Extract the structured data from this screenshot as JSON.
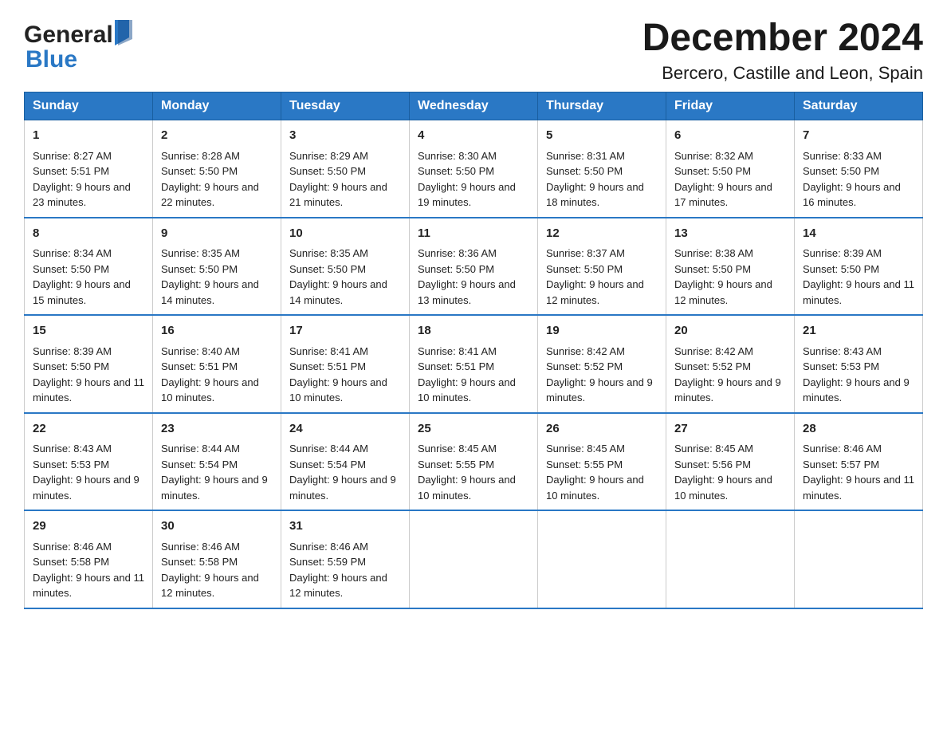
{
  "header": {
    "title": "December 2024",
    "subtitle": "Bercero, Castille and Leon, Spain",
    "logo_general": "General",
    "logo_blue": "Blue"
  },
  "days_of_week": [
    "Sunday",
    "Monday",
    "Tuesday",
    "Wednesday",
    "Thursday",
    "Friday",
    "Saturday"
  ],
  "weeks": [
    [
      {
        "day": "1",
        "sunrise": "8:27 AM",
        "sunset": "5:51 PM",
        "daylight": "9 hours and 23 minutes."
      },
      {
        "day": "2",
        "sunrise": "8:28 AM",
        "sunset": "5:50 PM",
        "daylight": "9 hours and 22 minutes."
      },
      {
        "day": "3",
        "sunrise": "8:29 AM",
        "sunset": "5:50 PM",
        "daylight": "9 hours and 21 minutes."
      },
      {
        "day": "4",
        "sunrise": "8:30 AM",
        "sunset": "5:50 PM",
        "daylight": "9 hours and 19 minutes."
      },
      {
        "day": "5",
        "sunrise": "8:31 AM",
        "sunset": "5:50 PM",
        "daylight": "9 hours and 18 minutes."
      },
      {
        "day": "6",
        "sunrise": "8:32 AM",
        "sunset": "5:50 PM",
        "daylight": "9 hours and 17 minutes."
      },
      {
        "day": "7",
        "sunrise": "8:33 AM",
        "sunset": "5:50 PM",
        "daylight": "9 hours and 16 minutes."
      }
    ],
    [
      {
        "day": "8",
        "sunrise": "8:34 AM",
        "sunset": "5:50 PM",
        "daylight": "9 hours and 15 minutes."
      },
      {
        "day": "9",
        "sunrise": "8:35 AM",
        "sunset": "5:50 PM",
        "daylight": "9 hours and 14 minutes."
      },
      {
        "day": "10",
        "sunrise": "8:35 AM",
        "sunset": "5:50 PM",
        "daylight": "9 hours and 14 minutes."
      },
      {
        "day": "11",
        "sunrise": "8:36 AM",
        "sunset": "5:50 PM",
        "daylight": "9 hours and 13 minutes."
      },
      {
        "day": "12",
        "sunrise": "8:37 AM",
        "sunset": "5:50 PM",
        "daylight": "9 hours and 12 minutes."
      },
      {
        "day": "13",
        "sunrise": "8:38 AM",
        "sunset": "5:50 PM",
        "daylight": "9 hours and 12 minutes."
      },
      {
        "day": "14",
        "sunrise": "8:39 AM",
        "sunset": "5:50 PM",
        "daylight": "9 hours and 11 minutes."
      }
    ],
    [
      {
        "day": "15",
        "sunrise": "8:39 AM",
        "sunset": "5:50 PM",
        "daylight": "9 hours and 11 minutes."
      },
      {
        "day": "16",
        "sunrise": "8:40 AM",
        "sunset": "5:51 PM",
        "daylight": "9 hours and 10 minutes."
      },
      {
        "day": "17",
        "sunrise": "8:41 AM",
        "sunset": "5:51 PM",
        "daylight": "9 hours and 10 minutes."
      },
      {
        "day": "18",
        "sunrise": "8:41 AM",
        "sunset": "5:51 PM",
        "daylight": "9 hours and 10 minutes."
      },
      {
        "day": "19",
        "sunrise": "8:42 AM",
        "sunset": "5:52 PM",
        "daylight": "9 hours and 9 minutes."
      },
      {
        "day": "20",
        "sunrise": "8:42 AM",
        "sunset": "5:52 PM",
        "daylight": "9 hours and 9 minutes."
      },
      {
        "day": "21",
        "sunrise": "8:43 AM",
        "sunset": "5:53 PM",
        "daylight": "9 hours and 9 minutes."
      }
    ],
    [
      {
        "day": "22",
        "sunrise": "8:43 AM",
        "sunset": "5:53 PM",
        "daylight": "9 hours and 9 minutes."
      },
      {
        "day": "23",
        "sunrise": "8:44 AM",
        "sunset": "5:54 PM",
        "daylight": "9 hours and 9 minutes."
      },
      {
        "day": "24",
        "sunrise": "8:44 AM",
        "sunset": "5:54 PM",
        "daylight": "9 hours and 9 minutes."
      },
      {
        "day": "25",
        "sunrise": "8:45 AM",
        "sunset": "5:55 PM",
        "daylight": "9 hours and 10 minutes."
      },
      {
        "day": "26",
        "sunrise": "8:45 AM",
        "sunset": "5:55 PM",
        "daylight": "9 hours and 10 minutes."
      },
      {
        "day": "27",
        "sunrise": "8:45 AM",
        "sunset": "5:56 PM",
        "daylight": "9 hours and 10 minutes."
      },
      {
        "day": "28",
        "sunrise": "8:46 AM",
        "sunset": "5:57 PM",
        "daylight": "9 hours and 11 minutes."
      }
    ],
    [
      {
        "day": "29",
        "sunrise": "8:46 AM",
        "sunset": "5:58 PM",
        "daylight": "9 hours and 11 minutes."
      },
      {
        "day": "30",
        "sunrise": "8:46 AM",
        "sunset": "5:58 PM",
        "daylight": "9 hours and 12 minutes."
      },
      {
        "day": "31",
        "sunrise": "8:46 AM",
        "sunset": "5:59 PM",
        "daylight": "9 hours and 12 minutes."
      },
      null,
      null,
      null,
      null
    ]
  ]
}
